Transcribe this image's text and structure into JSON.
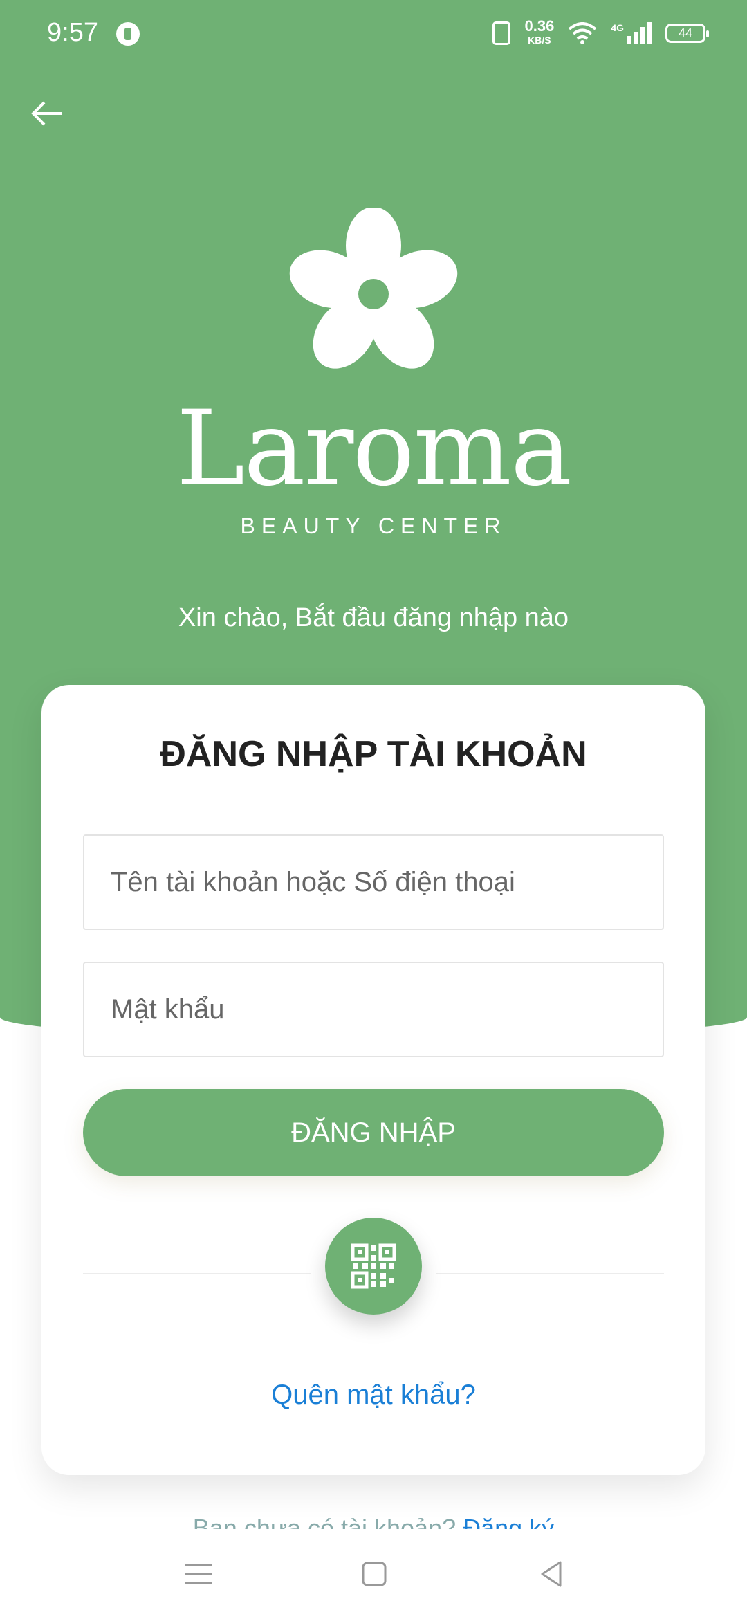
{
  "status_bar": {
    "time": "9:57",
    "net_speed": "0.36",
    "net_unit": "KB/S",
    "signal_label": "4G",
    "battery": "44"
  },
  "logo": {
    "name": "Laroma",
    "subtitle": "BEAUTY CENTER"
  },
  "greeting": "Xin chào, Bắt đầu đăng nhập nào",
  "login": {
    "title": "ĐĂNG NHẬP TÀI KHOẢN",
    "username_placeholder": "Tên tài khoản hoặc Số điện thoại",
    "password_placeholder": "Mật khẩu",
    "submit_label": "ĐĂNG NHẬP",
    "forgot_label": "Quên mật khẩu?"
  },
  "footer": {
    "register_prompt": "Bạn chưa có tài khoản?",
    "register_link": "Đăng ký"
  },
  "icons": {
    "back": "arrow-left-icon",
    "qr": "qr-code-icon",
    "nav_menu": "menu-icon",
    "nav_home": "square-icon",
    "nav_back": "triangle-back-icon"
  },
  "colors": {
    "brand_green": "#6fb174",
    "link_blue": "#1a7fd6",
    "title_text": "#222222"
  }
}
